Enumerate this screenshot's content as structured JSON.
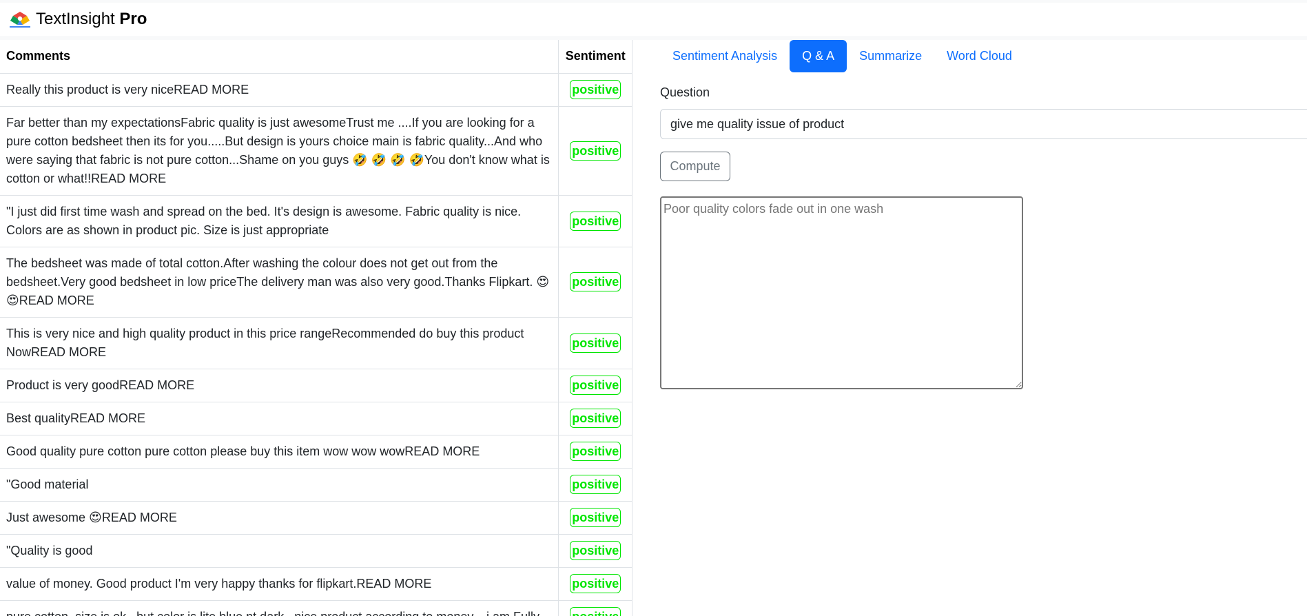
{
  "app": {
    "brand_name": "TextInsight",
    "brand_suffix": "Pro",
    "logo_icon": "rotating-color-logo-icon"
  },
  "table": {
    "headers": {
      "comments": "Comments",
      "sentiment": "Sentiment"
    },
    "rows": [
      {
        "comment": "Really this product is very niceREAD MORE",
        "sentiment": "positive"
      },
      {
        "comment": "Far better than my expectationsFabric quality is just awesomeTrust me ....If you are looking for a pure cotton bedsheet then its for you.....But design is yours choice main is fabric quality...And who were saying that fabric is not pure cotton...Shame on you guys 🤣 🤣 🤣 🤣You don't know what is cotton or what!!READ MORE",
        "sentiment": "positive"
      },
      {
        "comment": "\"I just did first time wash and spread on the bed. It's design is awesome. Fabric quality is nice. Colors are as shown in product pic. Size is just appropriate",
        "sentiment": "positive"
      },
      {
        "comment": "The bedsheet was made of total cotton.After washing the colour does not get out from the bedsheet.Very good bedsheet in low priceThe delivery man was also very good.Thanks Flipkart. 😍 😍READ MORE",
        "sentiment": "positive"
      },
      {
        "comment": "This is very nice and high quality product in this price rangeRecommended do buy this product NowREAD MORE",
        "sentiment": "positive"
      },
      {
        "comment": "Product is very goodREAD MORE",
        "sentiment": "positive"
      },
      {
        "comment": "Best qualityREAD MORE",
        "sentiment": "positive"
      },
      {
        "comment": "Good quality pure cotton pure cotton please buy this item wow wow wowREAD MORE",
        "sentiment": "positive"
      },
      {
        "comment": "\"Good material",
        "sentiment": "positive"
      },
      {
        "comment": "Just awesome 😍READ MORE",
        "sentiment": "positive"
      },
      {
        "comment": "\"Quality is good",
        "sentiment": "positive"
      },
      {
        "comment": "value of money. Good product I'm very happy thanks for flipkart.READ MORE",
        "sentiment": "positive"
      },
      {
        "comment": "pure cotton .size is ok ..but color is lite blue nt dark.. nice product according to money... i am Fully",
        "sentiment": "positive"
      }
    ]
  },
  "tabs": [
    {
      "label": "Sentiment Analysis",
      "active": false
    },
    {
      "label": "Q & A",
      "active": true
    },
    {
      "label": "Summarize",
      "active": false
    },
    {
      "label": "Word Cloud",
      "active": false
    }
  ],
  "qa": {
    "question_label": "Question",
    "question_value": "give me quality issue of product",
    "compute_label": "Compute",
    "answer_placeholder": "Poor quality colors fade out in one wash"
  },
  "colors": {
    "accent": "#0d6efd",
    "positive": "#00e600",
    "border": "#dee2e6"
  }
}
